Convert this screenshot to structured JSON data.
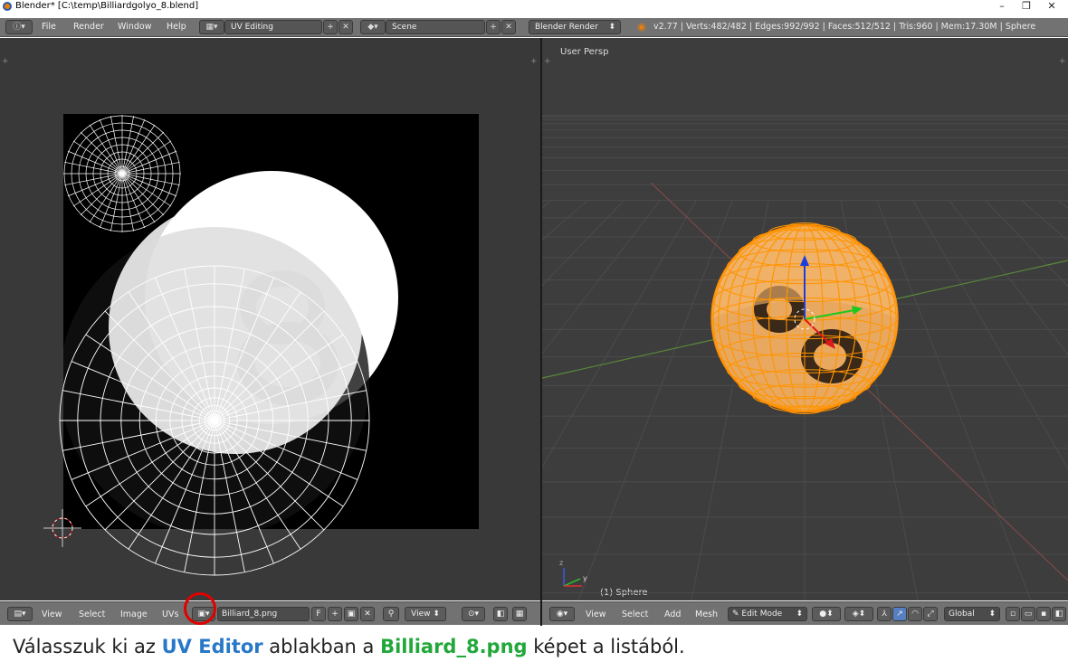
{
  "titlebar": {
    "title": "Blender* [C:\\temp\\Billiardgolyo_8.blend]",
    "minimize": "–",
    "restore": "❐",
    "close": "✕"
  },
  "info_header": {
    "menus": [
      "File",
      "Render",
      "Window",
      "Help"
    ],
    "layout": "UV Editing",
    "scene": "Scene",
    "engine": "Blender Render",
    "stats": "v2.77 | Verts:482/482 | Edges:992/992 | Faces:512/512 | Tris:960 | Mem:17.30M | Sphere"
  },
  "viewport": {
    "view_label": "User Persp",
    "object_label": "(1) Sphere",
    "header": {
      "menus": [
        "View",
        "Select",
        "Add",
        "Mesh"
      ],
      "mode": "Edit Mode",
      "orientation": "Global"
    }
  },
  "uv_editor": {
    "header": {
      "menus": [
        "View",
        "Select",
        "Image",
        "UVs"
      ],
      "image_name": "Billiard_8.png",
      "fake_user": "F",
      "view_select": "View"
    }
  },
  "caption": {
    "pre": "Válasszuk ki az ",
    "editor": "UV Editor",
    "mid": " ablakban a ",
    "image": "Billiard_8.png",
    "post": " képet a listából."
  },
  "colors": {
    "ui_header": "#727272",
    "editor_bg": "#393939",
    "selection": "#ff8c00",
    "highlight": "#e00000",
    "caption_editor": "#2878c8",
    "caption_image": "#22a83a"
  }
}
